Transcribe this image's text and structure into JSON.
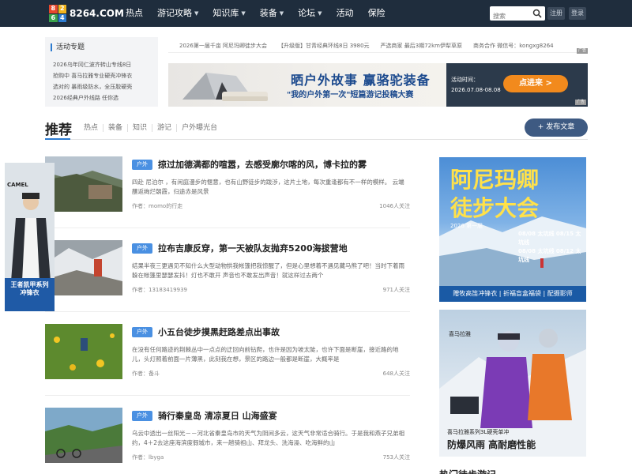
{
  "header": {
    "logo_text": "8264.COM",
    "logo_glyphs": [
      "8",
      "2",
      "6",
      "4"
    ],
    "nav": [
      {
        "label": "热点",
        "dropdown": false
      },
      {
        "label": "游记攻略",
        "dropdown": true
      },
      {
        "label": "知识库",
        "dropdown": true
      },
      {
        "label": "装备",
        "dropdown": true
      },
      {
        "label": "论坛",
        "dropdown": true
      },
      {
        "label": "活动",
        "dropdown": false
      },
      {
        "label": "保险",
        "dropdown": false
      }
    ],
    "search_placeholder": "搜索",
    "register_label": "注册",
    "login_label": "登录",
    "colors": {
      "bar": "#1f2d3d",
      "accent": "#2d7bd0"
    }
  },
  "activity": {
    "title": "活动专题",
    "items": [
      "2026乌年冈仁波齐转山专线8日",
      "抢购中 喜马拉雅专业硬壳冲锋衣",
      "选对的 暴雨级防水，全压胶硬壳",
      "2026经典户外线路 任你选"
    ]
  },
  "ticker": {
    "items": [
      "2026第一届千亩 阿尼玛卿徒步大会",
      "【升级版】甘青经典环线8日 3980元",
      "严选商家 最后3期72km伊犁草原",
      "商务合作 微信号：kongxg8264"
    ],
    "ad_label": "广告"
  },
  "banner": {
    "headline": "晒户外故事 赢骆驼装备",
    "subline": "\"我的户外第一次\"短篇游记投稿大赛",
    "time_label": "活动时间：",
    "time_value": "2026.07.08-08.08",
    "cta": "点进来 >",
    "ad_label": "广告"
  },
  "section": {
    "title": "推荐",
    "tabs": [
      "热点",
      "装备",
      "知识",
      "游记",
      "户外曝光台"
    ],
    "publish_label": "+ 发布文章"
  },
  "feed": [
    {
      "tag": "户外",
      "title": "掠过加德满都的喧嚣，去感受廓尔喀的风，博卡拉的雾",
      "excerpt": "四赴 尼泊尔 ，有闲庭漫步的惬意，也有山野徒步的跋涉，这片土地，每次重逢都有不一样的模样。 云端蘸返绚烂朝霞，归途赤是风景",
      "author": "作者：momo的行走",
      "follow": "1046人关注"
    },
    {
      "tag": "户外",
      "title": "拉布吉康反穿，第一天被队友抛弃5200海拔营地",
      "excerpt": "结果半夜三更遇见不知什么大型动物拱我帐篷把我惊醒了，但是心里想着不遇见藏马熊了吧！当时下着雨躲在帐篷里瑟瑟发抖！灯也不敢开 声音也不敢发出声音！就这样过去两个",
      "author": "作者：13183419939",
      "follow": "971人关注"
    },
    {
      "tag": "户外",
      "title": "小五台徒步摸黑赶路差点出事故",
      "excerpt": "在没有任何路迹的荆棘丛中一点点的迂回向前钻爬，也许是因为坡太陡，也许下面是断崖，接近路的地儿，头灯照着前面一片薄黑，此刻我在想，景区的路边一般都是断崖，大概率是",
      "author": "作者：备斗",
      "follow": "648人关注"
    },
    {
      "tag": "户外",
      "title": "骑行秦皇岛 清凉夏日 山海盛宴",
      "excerpt": "乌云中透出一丝阳光－－河北省秦皇岛市的天气为阴间多云，这天气非常适合骑行。于是我和燕子兄弟相约，4＋2去这座海滨度假城市，来一趟骑祖山、拜龙头、洗海澡、吃海鲜的山",
      "author": "作者：lbyga",
      "follow": "753人关注"
    }
  ],
  "left_ad": {
    "brand": "CAMEL",
    "caption_line1": "王者凯甲系列",
    "caption_line2": "冲锋衣"
  },
  "right_ad_1": {
    "title_line1": "阿尼玛卿",
    "title_line2": "徒步大会",
    "year_badge": "2026 第一届",
    "dates": [
      "08/08 太坑线  08/15 太坑线",
      "08/08 太坑线  08/12 太坑线"
    ],
    "footer": "赠牧高笛冲锋衣 | 折福盲盒福袋 | 配摄影师"
  },
  "right_ad_2": {
    "brand": "喜马拉雅",
    "small": "喜马拉雅系列3L硬壳单冲",
    "big": "防爆风雨 高耐磨性能"
  },
  "bottom_heading": "热门徒步游记"
}
